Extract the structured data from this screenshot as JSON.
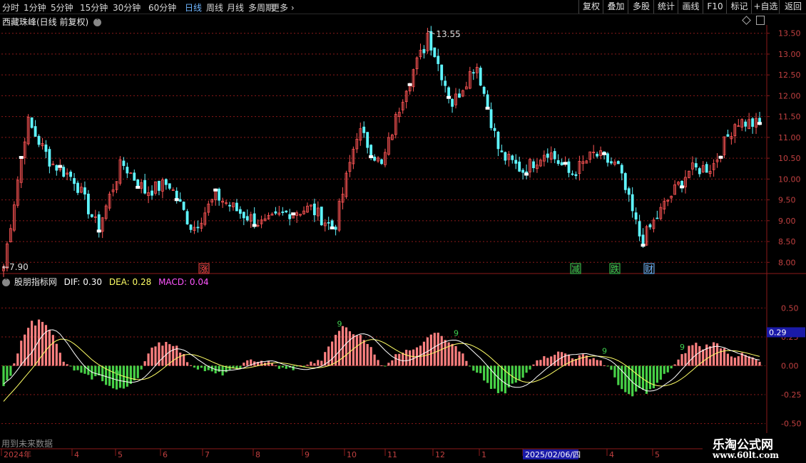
{
  "toolbar": {
    "periods": [
      {
        "label": "分时",
        "active": false
      },
      {
        "label": "1分钟",
        "active": false
      },
      {
        "label": "5分钟",
        "active": false
      },
      {
        "label": "15分钟",
        "active": false
      },
      {
        "label": "30分钟",
        "active": false
      },
      {
        "label": "60分钟",
        "active": false
      },
      {
        "label": "日线",
        "active": true
      },
      {
        "label": "周线",
        "active": false
      },
      {
        "label": "月线",
        "active": false
      },
      {
        "label": "多周期",
        "active": false
      },
      {
        "label": "更多",
        "active": false
      }
    ],
    "more_arrow": "›",
    "buttons": [
      "复权",
      "叠加",
      "多股",
      "统计",
      "画线",
      "F10",
      "标记",
      "+自选",
      "返回"
    ]
  },
  "main_panel": {
    "title": "西藏珠峰(日线 前复权)",
    "high_marker": "13.55",
    "low_marker": "7.90",
    "signals": [
      {
        "text": "涨",
        "color": "#ff4040"
      },
      {
        "text": "减",
        "color": "#3fd14f"
      },
      {
        "text": "跌",
        "color": "#3fd14f"
      },
      {
        "text": "财",
        "color": "#6fb6ff"
      }
    ]
  },
  "indicator_panel": {
    "name": "股朋指标网",
    "dif_label": "DIF: 0.30",
    "dea_label": "DEA: 0.28",
    "macd_label": "MACD: 0.04",
    "current_value": "0.29",
    "count_labels": [
      "9",
      "9",
      "9",
      "9",
      "9"
    ],
    "footer_note": "用到未来数据"
  },
  "time_axis": {
    "labels": [
      "2024年",
      "4",
      "5",
      "6",
      "7",
      "8",
      "9",
      "10",
      "11",
      "12",
      "1",
      "2025/02/06/四",
      "4",
      "5"
    ]
  },
  "watermark": {
    "title": "乐淘公式网",
    "url": "www.60lt.com"
  },
  "colors": {
    "up": "#ff5555",
    "down": "#5ff5ff",
    "bar_up": "#ff8080",
    "bar_down": "#47d147",
    "dif": "#ffffff",
    "dea": "#ffff66",
    "macd_text": "#ff55ff",
    "grid": "#8b1a1a"
  },
  "chart_data": [
    {
      "type": "candlestick",
      "title": "西藏珠峰(日线 前复权)",
      "y_ticks": [
        "8.00",
        "8.50",
        "9.00",
        "9.50",
        "10.00",
        "10.50",
        "11.00",
        "11.50",
        "12.00",
        "12.50",
        "13.00",
        "13.50"
      ],
      "ylim": [
        7.8,
        13.7
      ],
      "max_value": 13.55,
      "min_value": 7.9,
      "approx_close_path": [
        [
          "2024-02",
          7.9
        ],
        [
          "2024-03",
          11.4
        ],
        [
          "2024-03",
          10.4
        ],
        [
          "2024-04",
          10.0
        ],
        [
          "2024-04",
          8.8
        ],
        [
          "2024-05",
          10.4
        ],
        [
          "2024-05",
          9.7
        ],
        [
          "2024-06",
          9.9
        ],
        [
          "2024-06",
          8.8
        ],
        [
          "2024-07",
          9.6
        ],
        [
          "2024-07",
          9.2
        ],
        [
          "2024-08",
          8.9
        ],
        [
          "2024-08",
          9.2
        ],
        [
          "2024-09",
          9.3
        ],
        [
          "2024-09",
          8.8
        ],
        [
          "2024-10",
          11.2
        ],
        [
          "2024-10",
          10.3
        ],
        [
          "2024-11",
          12.2
        ],
        [
          "2024-11",
          13.4
        ],
        [
          "2024-12",
          11.8
        ],
        [
          "2024-12",
          12.8
        ],
        [
          "2025-01",
          10.6
        ],
        [
          "2025-01",
          10.2
        ],
        [
          "2025-02",
          10.7
        ],
        [
          "2025-02",
          10.1
        ],
        [
          "2025-03",
          10.6
        ],
        [
          "2025-03",
          10.3
        ],
        [
          "2025-04",
          8.5
        ],
        [
          "2025-04",
          9.4
        ],
        [
          "2025-05",
          10.2
        ],
        [
          "2025-05",
          10.3
        ],
        [
          "2025-06",
          11.4
        ],
        [
          "2025-06",
          11.3
        ]
      ]
    },
    {
      "type": "bar",
      "title": "股朋指标网",
      "y_ticks": [
        "0.50",
        "0.25",
        "0.00",
        "-0.25",
        "-0.50"
      ],
      "ylim": [
        -0.7,
        0.7
      ],
      "series": [
        {
          "name": "DIF",
          "value": 0.3
        },
        {
          "name": "DEA",
          "value": 0.28
        },
        {
          "name": "MACD",
          "value": 0.04
        }
      ],
      "approx_macd_path": [
        [
          "2024-02",
          -0.3
        ],
        [
          "2024-03",
          0.6
        ],
        [
          "2024-03",
          0.0
        ],
        [
          "2024-04",
          -0.15
        ],
        [
          "2024-04",
          -0.25
        ],
        [
          "2024-05",
          0.32
        ],
        [
          "2024-05",
          0.0
        ],
        [
          "2024-06",
          -0.1
        ],
        [
          "2024-07",
          0.08
        ],
        [
          "2024-08",
          -0.05
        ],
        [
          "2024-09",
          0.05
        ],
        [
          "2024-10",
          0.45
        ],
        [
          "2024-10",
          0.0
        ],
        [
          "2024-11",
          0.2
        ],
        [
          "2024-12",
          0.35
        ],
        [
          "2024-12",
          -0.1
        ],
        [
          "2025-01",
          -0.3
        ],
        [
          "2025-01",
          0.1
        ],
        [
          "2025-02",
          0.12
        ],
        [
          "2025-03",
          0.05
        ],
        [
          "2025-04",
          -0.35
        ],
        [
          "2025-04",
          -0.1
        ],
        [
          "2025-05",
          0.25
        ],
        [
          "2025-06",
          0.15
        ],
        [
          "2025-06",
          0.04
        ]
      ]
    }
  ]
}
